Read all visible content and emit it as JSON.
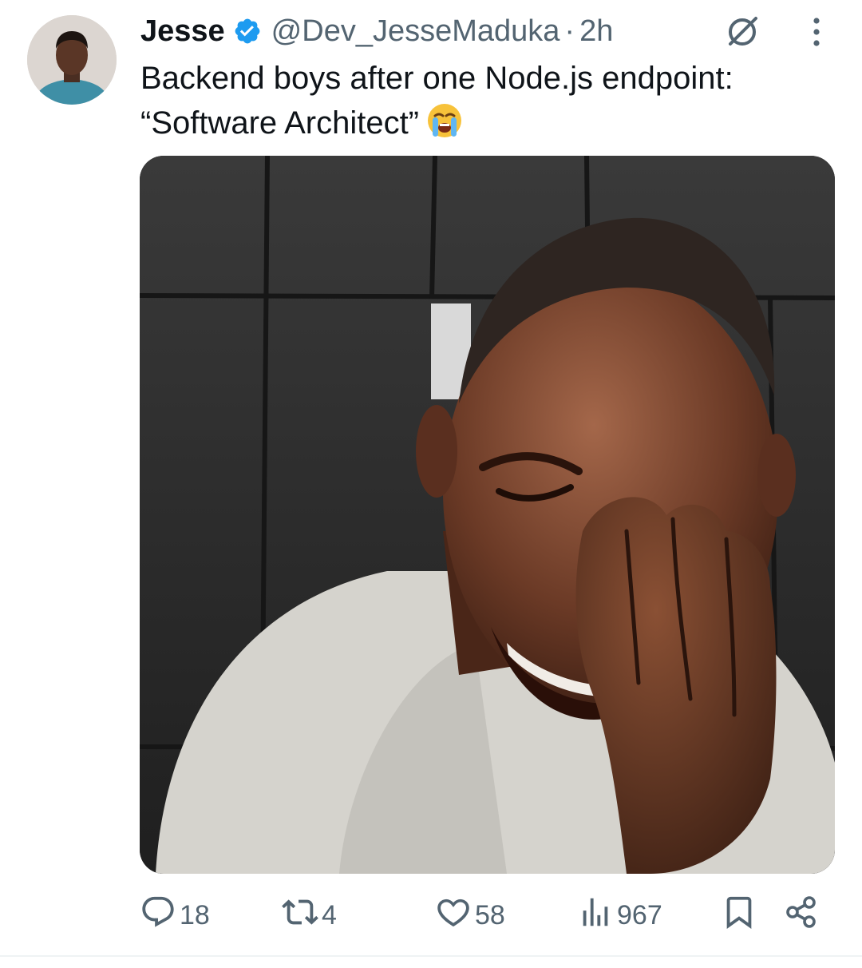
{
  "tweet": {
    "author": {
      "display_name": "Jesse",
      "handle": "@Dev_JesseMaduka",
      "verified": true
    },
    "separator": "·",
    "time": "2h",
    "text_lines": [
      "Backend boys after one Node.js endpoint:",
      "“Software Architect”"
    ],
    "emoji": "loudly-crying-face",
    "media": {
      "type": "photo"
    },
    "actions": {
      "replies": "18",
      "reposts": "4",
      "likes": "58",
      "views": "967"
    }
  },
  "icons": {
    "verified": "verified-badge-icon",
    "grok": "grok-icon",
    "more": "more-vertical-icon",
    "reply": "reply-icon",
    "repost": "repost-icon",
    "like": "heart-icon",
    "views": "views-icon",
    "bookmark": "bookmark-icon",
    "share": "share-icon"
  },
  "colors": {
    "text": "#0f1419",
    "secondary": "#536471",
    "verified": "#1d9bf0",
    "divider": "#eff3f4"
  }
}
